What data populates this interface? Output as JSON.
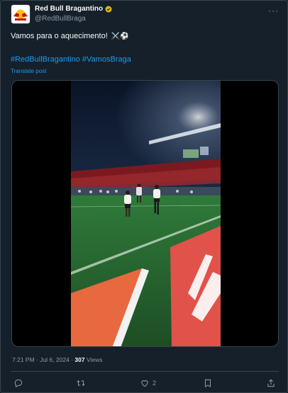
{
  "post": {
    "display_name": "Red Bull Bragantino",
    "handle": "@RedBullBraga",
    "text": "Vamos para o aquecimento!",
    "emoji": "⚔️⚽",
    "hashtags": [
      "#RedBullBragantino",
      "#VamosBraga"
    ],
    "translate_label": "Translate post",
    "timestamp": "7:21 PM · Jul 6, 2024",
    "separator": "·",
    "views_count": "307",
    "views_label": "Views"
  },
  "actions": {
    "reply_count": "",
    "repost_count": "",
    "like_count": "2"
  },
  "colors": {
    "background": "#15202b",
    "link": "#1d9bf0",
    "secondary_text": "#8b98a5",
    "verified_badge": "#e2b719",
    "brand_red": "#d20515"
  },
  "icons": [
    "verified-badge-icon",
    "more-options-icon",
    "reply-icon",
    "repost-icon",
    "like-icon",
    "bookmark-icon",
    "share-icon"
  ]
}
